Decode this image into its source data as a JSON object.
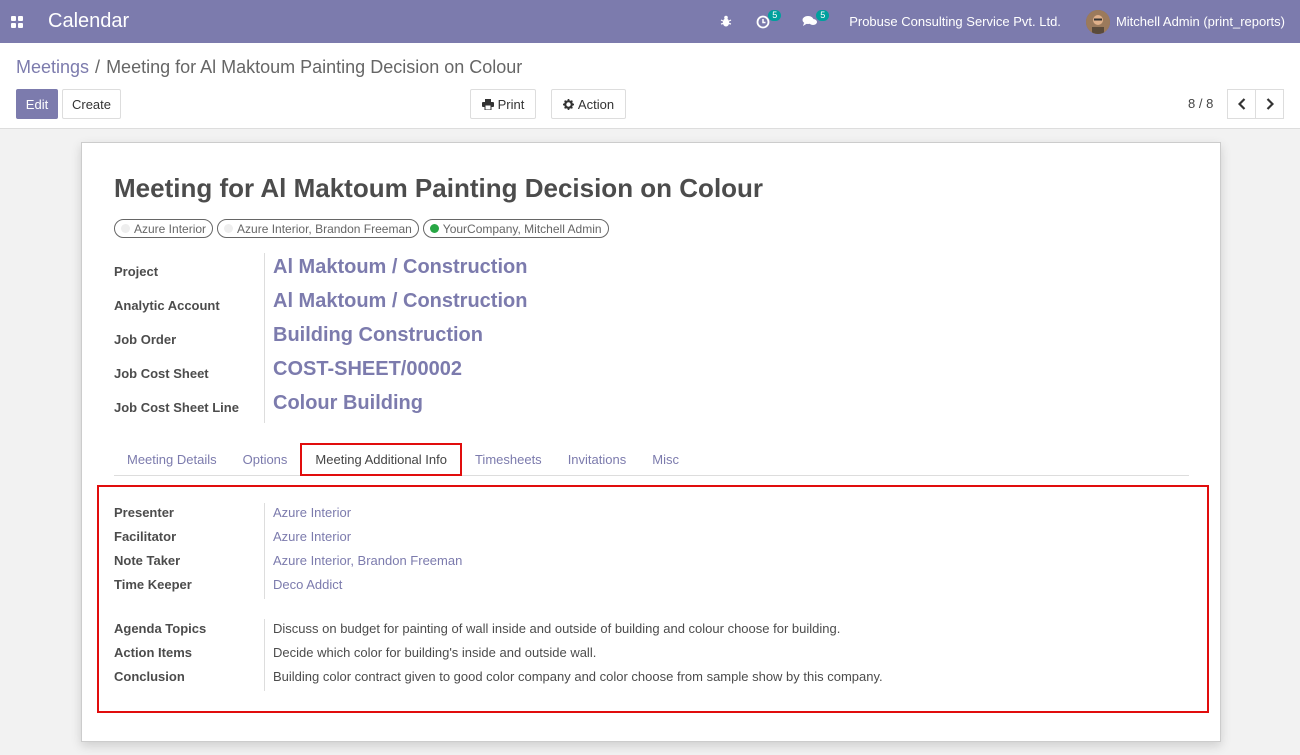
{
  "navbar": {
    "app_title": "Calendar",
    "activity_count": "5",
    "messages_count": "5",
    "company": "Probuse Consulting Service Pvt. Ltd.",
    "user": "Mitchell Admin (print_reports)"
  },
  "breadcrumb": {
    "parent": "Meetings",
    "separator": "/",
    "current": "Meeting for Al Maktoum Painting Decision on Colour"
  },
  "buttons": {
    "edit": "Edit",
    "create": "Create",
    "print": "Print",
    "action": "Action"
  },
  "pager": {
    "value": "8 / 8"
  },
  "form": {
    "title": "Meeting for Al Maktoum Painting Decision on Colour",
    "tags": [
      {
        "label": "Azure Interior"
      },
      {
        "label": "Azure Interior, Brandon Freeman"
      },
      {
        "label": "YourCompany, Mitchell Admin"
      }
    ],
    "fields": [
      {
        "label": "Project",
        "value": "Al Maktoum / Construction"
      },
      {
        "label": "Analytic Account",
        "value": "Al Maktoum / Construction"
      },
      {
        "label": "Job Order",
        "value": "Building Construction"
      },
      {
        "label": "Job Cost Sheet",
        "value": "COST-SHEET/00002"
      },
      {
        "label": "Job Cost Sheet Line",
        "value": "Colour Building"
      }
    ],
    "tabs": [
      {
        "label": "Meeting Details"
      },
      {
        "label": "Options"
      },
      {
        "label": "Meeting Additional Info"
      },
      {
        "label": "Timesheets"
      },
      {
        "label": "Invitations"
      },
      {
        "label": "Misc"
      }
    ],
    "roles": [
      {
        "label": "Presenter",
        "value": "Azure Interior"
      },
      {
        "label": "Facilitator",
        "value": "Azure Interior"
      },
      {
        "label": "Note Taker",
        "value": "Azure Interior, Brandon Freeman"
      },
      {
        "label": "Time Keeper",
        "value": "Deco Addict"
      }
    ],
    "notes": [
      {
        "label": "Agenda Topics",
        "value": "Discuss on budget for painting of wall inside and outside of building and colour choose for building."
      },
      {
        "label": "Action Items",
        "value": "Decide which color for building's inside and outside wall."
      },
      {
        "label": "Conclusion",
        "value": "Building color contract given to good color company and color choose from sample show by this company."
      }
    ]
  },
  "colors": {
    "brand": "#7c7bad",
    "highlight": "#e10d0d",
    "badge": "#00a09d"
  }
}
